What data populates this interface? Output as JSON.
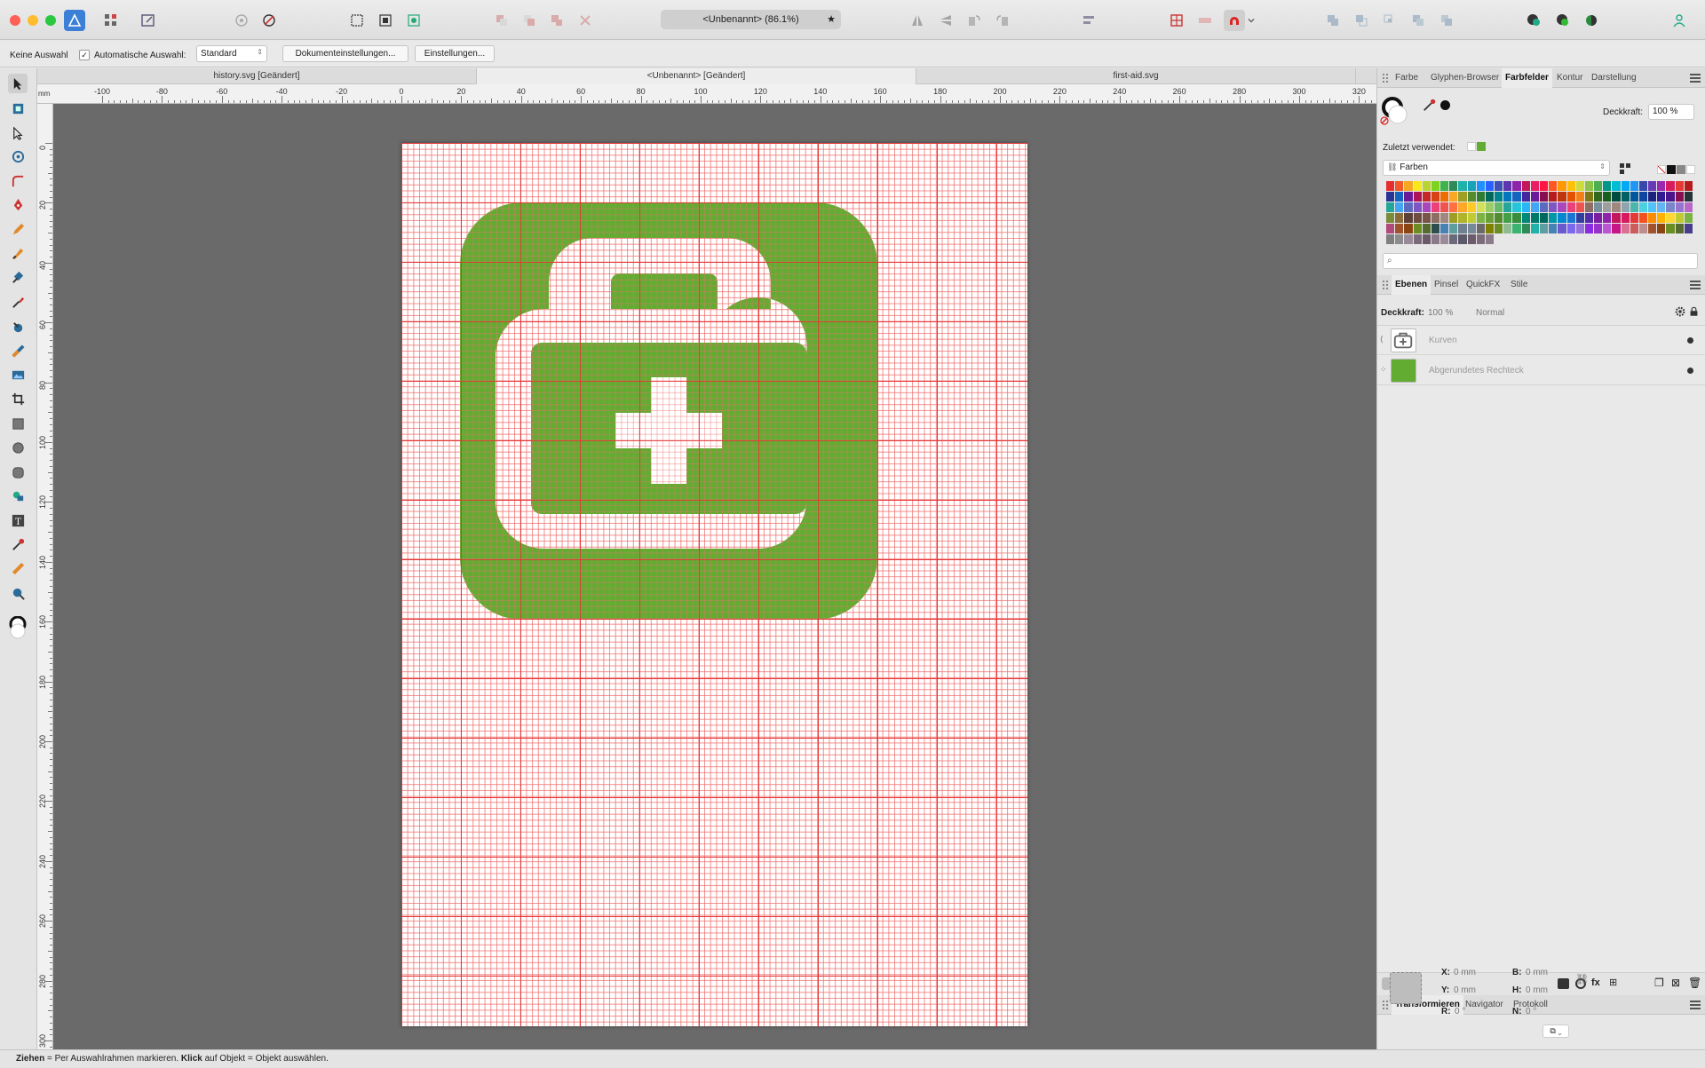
{
  "window": {
    "title": "<Unbenannt> (86.1%)",
    "modified_marker": "★"
  },
  "context_bar": {
    "selection": "Keine Auswahl",
    "auto_select_label": "Automatische Auswahl:",
    "auto_select_value": "Standard",
    "doc_settings": "Dokumenteinstellungen...",
    "settings": "Einstellungen..."
  },
  "doc_tabs": [
    {
      "label": "history.svg [Geändert]"
    },
    {
      "label": "<Unbenannt> [Geändert]"
    },
    {
      "label": "first-aid.svg"
    }
  ],
  "ruler": {
    "unit": "mm",
    "h_labels": [
      "-100",
      "-80",
      "-60",
      "-40",
      "-20",
      "0",
      "20",
      "40",
      "60",
      "80",
      "100",
      "120",
      "140",
      "160",
      "180",
      "200",
      "220",
      "240",
      "260",
      "280",
      "300",
      "320"
    ],
    "v_labels": [
      "0",
      "20",
      "40",
      "60",
      "80",
      "100",
      "120",
      "140",
      "160",
      "180",
      "200",
      "220",
      "240",
      "260",
      "280",
      "300"
    ]
  },
  "artwork": {
    "icon": "first-aid-kit-icon",
    "fill_color": "#62ac32",
    "cutout_color": "#ffffff"
  },
  "colors": {
    "grid_major": "#e63232",
    "grid_minor": "#f06e6e",
    "canvas_bg": "#6a6a6a"
  },
  "panels": {
    "top_tabs": [
      "Farbe",
      "Glyphen-Browser",
      "Farbfelder",
      "Kontur",
      "Darstellung"
    ],
    "top_active": "Farbfelder",
    "opacity_label": "Deckkraft:",
    "opacity_value": "100 %",
    "recent_label": "Zuletzt verwendet:",
    "palette_name": "Farben",
    "layer_tabs": [
      "Ebenen",
      "Pinsel",
      "QuickFX",
      "Stile"
    ],
    "layer_active": "Ebenen",
    "layer_opacity_label": "Deckkraft:",
    "layer_opacity_value": "100 %",
    "blend_mode": "Normal",
    "layers": [
      {
        "name": "Kurven"
      },
      {
        "name": "Abgerundetes Rechteck"
      }
    ],
    "transform_tabs": [
      "Transformieren",
      "Navigator",
      "Protokoll"
    ],
    "transform_active": "Transformieren",
    "transform": {
      "x_label": "X:",
      "x_value": "0 mm",
      "y_label": "Y:",
      "y_value": "0 mm",
      "b_label": "B:",
      "b_value": "0 mm",
      "h_label": "H:",
      "h_value": "0 mm",
      "r_label": "R:",
      "r_value": "0 °",
      "n_label": "N:",
      "n_value": "0 °"
    }
  },
  "status": {
    "drag_key": "Ziehen",
    "drag_text": " = Per Auswahlrahmen markieren. ",
    "click_key": "Klick",
    "click_text": " auf Objekt = Objekt auswählen."
  }
}
